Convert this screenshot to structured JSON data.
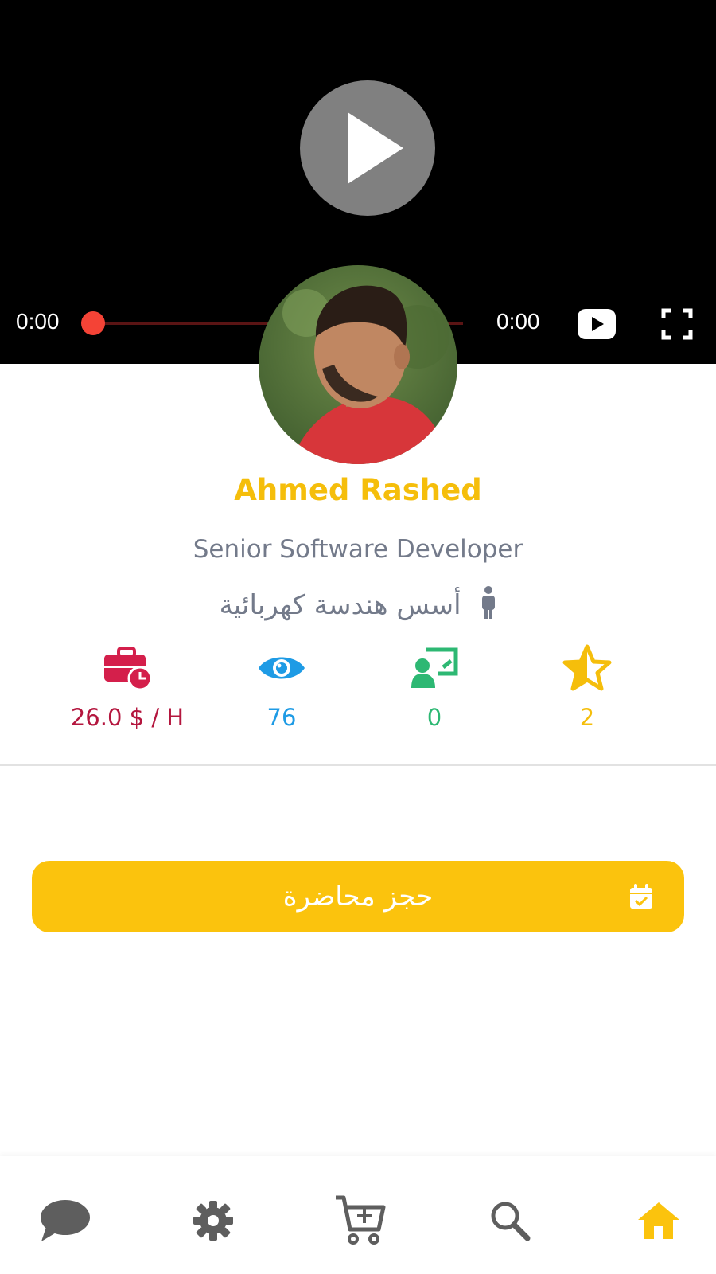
{
  "video": {
    "current_time": "0:00",
    "duration": "0:00",
    "progress": 0
  },
  "profile": {
    "name": "Ahmed Rashed",
    "title": "Senior Software Developer",
    "department": "أسس هندسة كهربائية"
  },
  "stats": {
    "hourly_rate": "26.0 $ / H",
    "views": "76",
    "lessons": "0",
    "rating": "2"
  },
  "actions": {
    "book_lecture": "حجز محاضرة"
  },
  "colors": {
    "accent": "#fbc30d",
    "rate": "#b4163e",
    "views": "#1e9be5",
    "lessons": "#2db873",
    "rating": "#f5be0b",
    "muted_text": "#737a8a"
  },
  "bottom_nav": {
    "items": [
      "chat-icon",
      "settings-icon",
      "add-to-cart-icon",
      "search-icon",
      "home-icon"
    ],
    "active": "home-icon"
  }
}
